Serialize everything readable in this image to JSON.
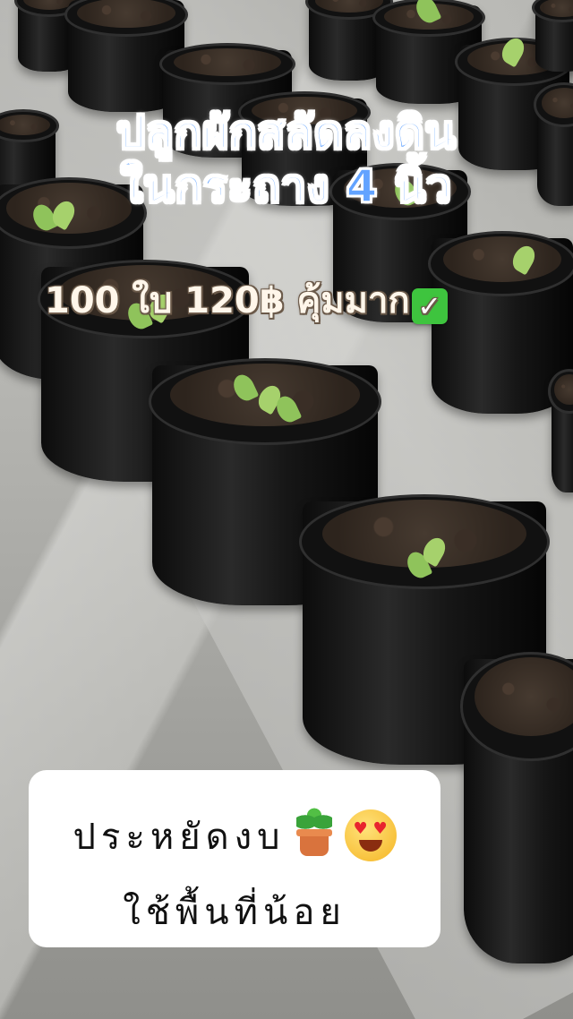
{
  "overlay": {
    "title_line_1": "ปลูกผักสลัดลงดิน",
    "title_line_2": "ในกระถาง 4 นิ้ว",
    "price_text": "100 ใบ 120฿ คุ้มมาก",
    "price_emoji": "check-mark-button-icon",
    "card_line_1": "ประหยัดงบ",
    "card_line_1_emojis": [
      "potted-plant-icon",
      "smiling-face-with-heart-eyes-icon"
    ],
    "card_line_2": "ใช้พื้นที่น้อย"
  },
  "colors": {
    "title_fill": "#62a3ff",
    "title_outline": "#ffffff",
    "price_fill": "#fff6ea",
    "card_background": "#ffffff",
    "card_text": "#111111",
    "check_emoji_green": "#3ec43e"
  }
}
